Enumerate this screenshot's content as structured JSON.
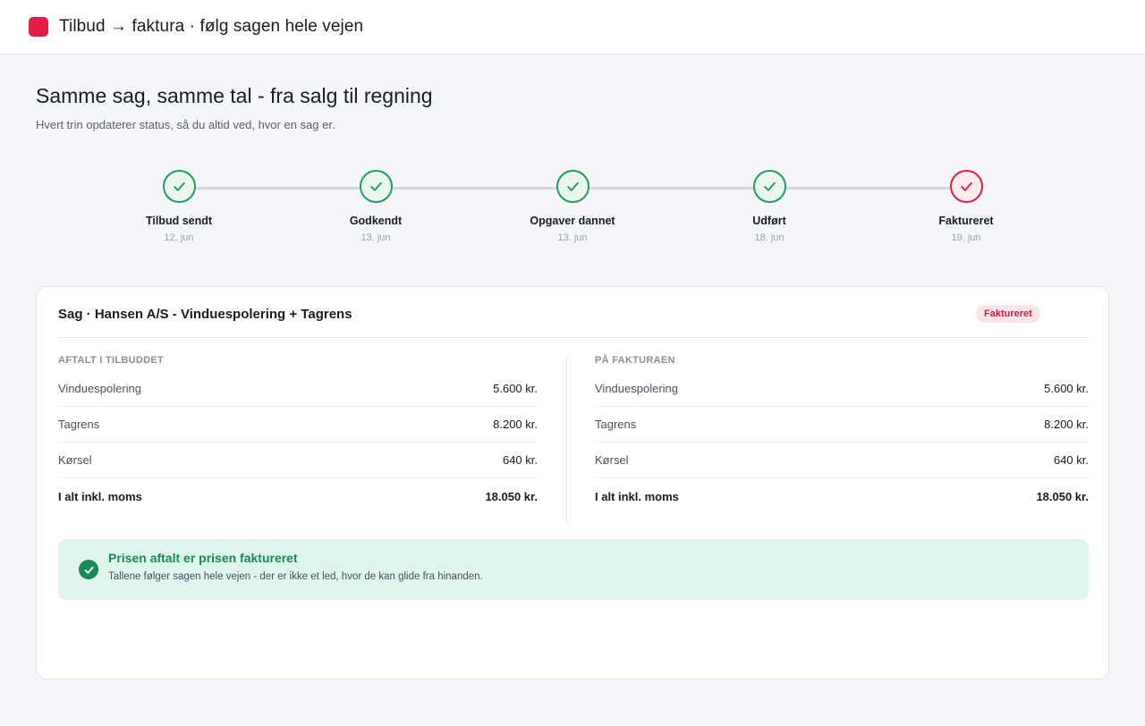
{
  "header": {
    "app_title": "Tilbud → faktura · følg sagen hele vejen",
    "brand_color": "#e11d48"
  },
  "intro": {
    "title": "Samme sag, samme tal - fra salg til regning",
    "subtitle": "Hvert trin opdaterer status, så du altid ved, hvor en sag er."
  },
  "steps": [
    {
      "label": "Tilbud sendt",
      "date": "12. jun",
      "state": "done",
      "icon": "check-icon"
    },
    {
      "label": "Godkendt",
      "date": "13. jun",
      "state": "done",
      "icon": "check-icon"
    },
    {
      "label": "Opgaver dannet",
      "date": "13. jun",
      "state": "done",
      "icon": "check-icon"
    },
    {
      "label": "Udført",
      "date": "18. jun",
      "state": "done",
      "icon": "check-icon"
    },
    {
      "label": "Faktureret",
      "date": "19. jun",
      "state": "current",
      "icon": "check-icon"
    }
  ],
  "case": {
    "title": "Sag · Hansen A/S - Vinduespolering + Tagrens",
    "status_badge": "Faktureret",
    "offer": {
      "heading": "AFTALT I TILBUDDET",
      "lines": [
        {
          "name": "Vinduespolering",
          "amount": "5.600 kr."
        },
        {
          "name": "Tagrens",
          "amount": "8.200 kr."
        },
        {
          "name": "Kørsel",
          "amount": "640 kr."
        }
      ],
      "total_label": "I alt inkl. moms",
      "total_amount": "18.050 kr."
    },
    "invoice": {
      "heading": "PÅ FAKTURAEN",
      "lines": [
        {
          "name": "Vinduespolering",
          "amount": "5.600 kr."
        },
        {
          "name": "Tagrens",
          "amount": "8.200 kr."
        },
        {
          "name": "Kørsel",
          "amount": "640 kr."
        }
      ],
      "total_label": "I alt inkl. moms",
      "total_amount": "18.050 kr."
    },
    "notice": {
      "title": "Prisen aftalt er prisen faktureret",
      "text": "Tallene følger sagen hele vejen - der er ikke et led, hvor de kan glide fra hinanden.",
      "icon": "check-circle-icon",
      "color": "#178a58"
    }
  },
  "colors": {
    "done": "#1f9d63",
    "current": "#e11d48"
  }
}
